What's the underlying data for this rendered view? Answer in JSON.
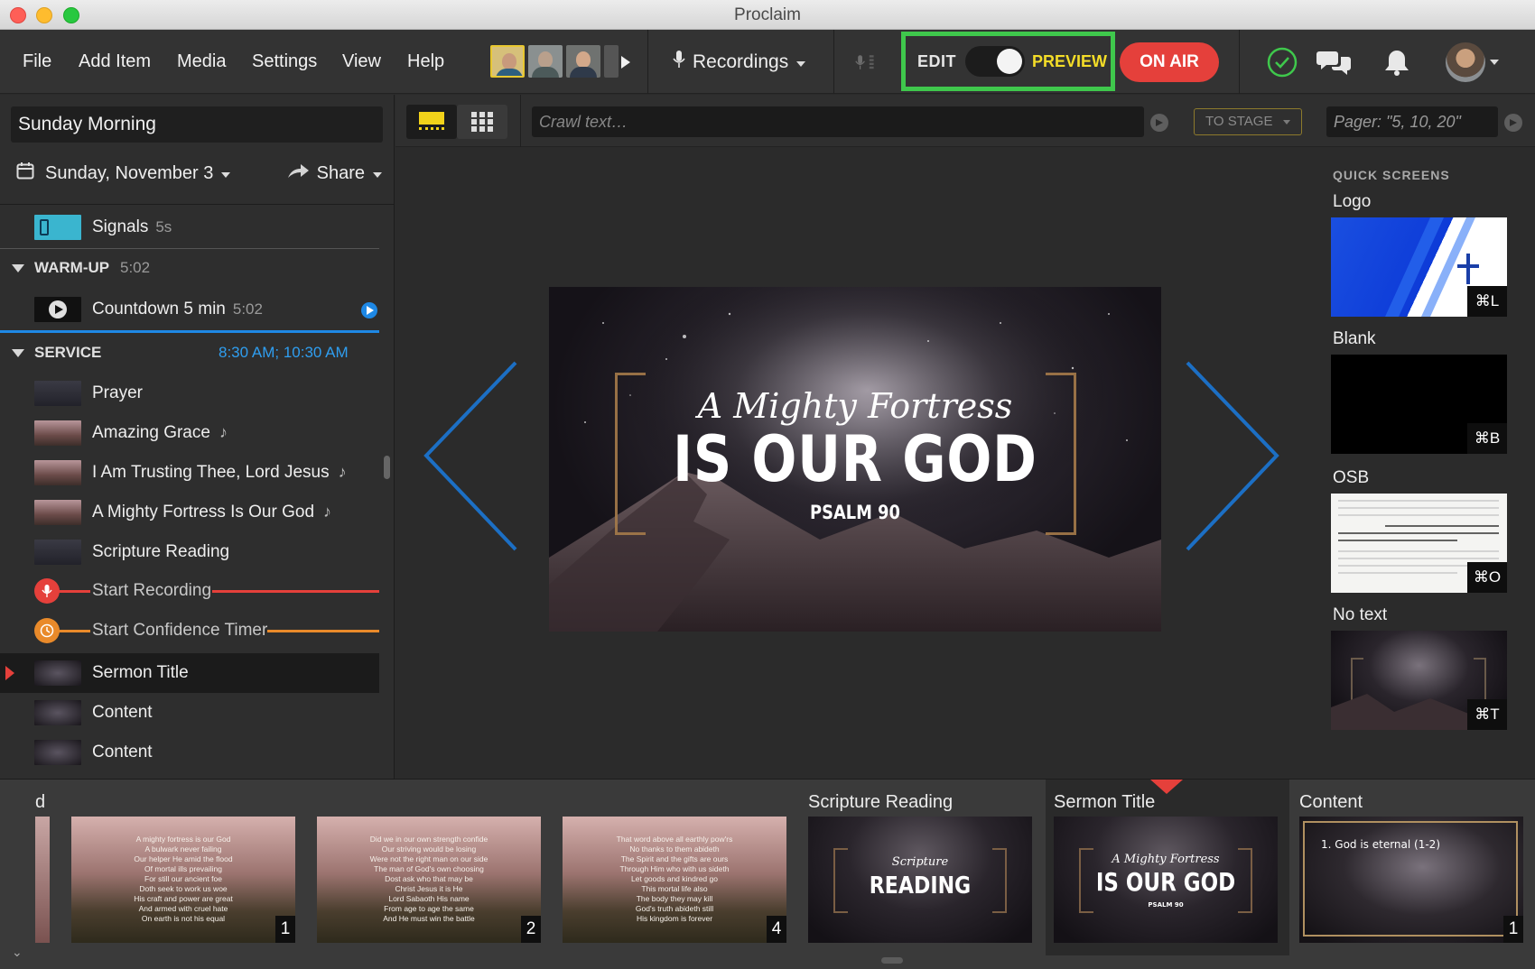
{
  "window": {
    "title": "Proclaim"
  },
  "menu": {
    "file": "File",
    "add_item": "Add Item",
    "media": "Media",
    "settings": "Settings",
    "view": "View",
    "help": "Help"
  },
  "recordings": {
    "label": "Recordings"
  },
  "mode": {
    "edit": "EDIT",
    "preview": "PREVIEW"
  },
  "on_air": {
    "label": "ON AIR"
  },
  "service": {
    "title": "Sunday Morning",
    "date": "Sunday, November 3",
    "share": "Share"
  },
  "items": {
    "signals": {
      "label": "Signals",
      "duration": "5s"
    },
    "warmup": {
      "label": "WARM-UP",
      "duration": "5:02"
    },
    "countdown": {
      "label": "Countdown 5 min",
      "duration": "5:02"
    },
    "service_section": {
      "label": "SERVICE",
      "times": "8:30 AM; 10:30 AM"
    },
    "prayer": {
      "label": "Prayer"
    },
    "amazing_grace": {
      "label": "Amazing Grace"
    },
    "trusting": {
      "label": "I Am Trusting Thee, Lord Jesus"
    },
    "fortress": {
      "label": "A Mighty Fortress Is Our God"
    },
    "scripture": {
      "label": "Scripture Reading"
    },
    "start_recording": {
      "label": "Start Recording"
    },
    "confidence": {
      "label": "Start Confidence Timer"
    },
    "sermon": {
      "label": "Sermon Title"
    },
    "content1": {
      "label": "Content"
    },
    "content2": {
      "label": "Content"
    }
  },
  "toolbar": {
    "crawl_placeholder": "Crawl text…",
    "to_stage": "TO STAGE",
    "pager_placeholder": "Pager: \"5, 10, 20\""
  },
  "slide": {
    "script_title": "A Mighty Fortress",
    "main_title": "IS OUR GOD",
    "subtitle": "PSALM 90"
  },
  "quick_screens": {
    "heading": "QUICK SCREENS",
    "items": [
      {
        "label": "Logo",
        "shortcut": "⌘L"
      },
      {
        "label": "Blank",
        "shortcut": "⌘B"
      },
      {
        "label": "OSB",
        "shortcut": "⌘O"
      },
      {
        "label": "No text",
        "shortcut": "⌘T"
      }
    ]
  },
  "filmstrip": {
    "partial_label": "d",
    "lyrics1": [
      "A mighty fortress is our God",
      "A bulwark never failing",
      "Our helper He amid the flood",
      "Of mortal ills prevailing",
      "For still our ancient foe",
      "Doth seek to work us woe",
      "His craft and power are great",
      "And armed with cruel hate",
      "On earth is not his equal"
    ],
    "lyrics2": [
      "Did we in our own strength confide",
      "Our striving would be losing",
      "Were not the right man on our side",
      "The man of God's own choosing",
      "Dost ask who that may be",
      "Christ Jesus it is He",
      "Lord Sabaoth His name",
      "From age to age the same",
      "And He must win the battle"
    ],
    "lyrics3": [
      "That word above all earthly pow'rs",
      "No thanks to them abideth",
      "The Spirit and the gifts are ours",
      "Through Him who with us sideth",
      "Let goods and kindred go",
      "This mortal life also",
      "The body they may kill",
      "God's truth abideth still",
      "His kingdom is forever"
    ],
    "nums": [
      "1",
      "2",
      "4",
      "1"
    ],
    "scripture_label": "Scripture Reading",
    "scripture_script": "Scripture",
    "scripture_main": "READING",
    "sermon_label": "Sermon Title",
    "sermon_script": "A Mighty Fortress",
    "sermon_main": "IS OUR GOD",
    "sermon_sub": "PSALM 90",
    "content_label": "Content",
    "content_text": "1. God is eternal (1-2)"
  },
  "colors": {
    "accent_blue": "#1e88e5",
    "on_air": "#e5403b",
    "preview_yellow": "#f4dd28",
    "highlight_green": "#3fc84c",
    "recording_red": "#e5403b",
    "timer_orange": "#e98a2a"
  }
}
